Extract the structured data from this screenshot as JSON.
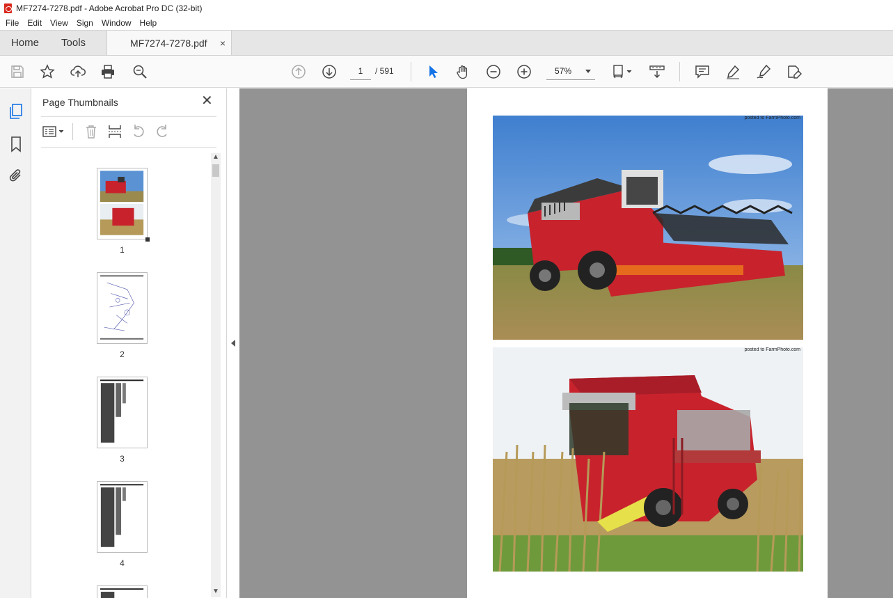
{
  "window": {
    "title": "MF7274-7278.pdf - Adobe Acrobat Pro DC (32-bit)"
  },
  "menu": [
    "File",
    "Edit",
    "View",
    "Sign",
    "Window",
    "Help"
  ],
  "tabs": {
    "home": "Home",
    "tools": "Tools",
    "document": "MF7274-7278.pdf",
    "close": "×"
  },
  "toolbar": {
    "current_page": "1",
    "page_total": "/ 591",
    "zoom": "57%"
  },
  "panel": {
    "title": "Page Thumbnails",
    "thumbnails": [
      {
        "label": "1"
      },
      {
        "label": "2"
      },
      {
        "label": "3"
      },
      {
        "label": "4"
      }
    ]
  },
  "document": {
    "photo_credit_1": "posted to FarmPhoto.com",
    "photo_credit_2": "posted to FarmPhoto.com"
  },
  "colors": {
    "accent": "#1473e6",
    "combine_red": "#c8232d",
    "sky": "#4f8fd6",
    "field": "#b59a5a"
  }
}
